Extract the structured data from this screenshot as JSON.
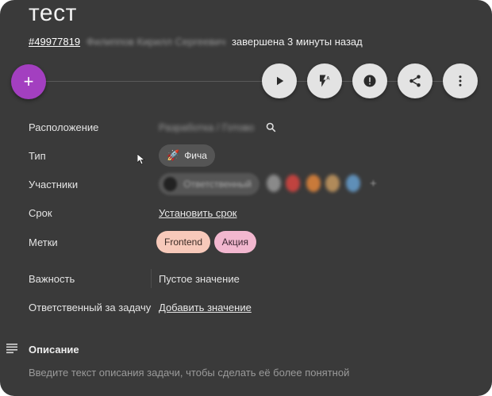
{
  "task": {
    "title": "тест",
    "id": "#49977819",
    "author": "Филиппов Кирилл Сергеевич",
    "status_text": "завершена 3 минуты назад"
  },
  "toolbar": {
    "add_label": "+",
    "buttons": [
      "play-icon",
      "flash-auto-icon",
      "priority-icon",
      "share-icon",
      "more-icon"
    ]
  },
  "fields": {
    "location": {
      "label": "Расположение",
      "value": "Разработка / Готово"
    },
    "type": {
      "label": "Тип",
      "emoji": "🚀",
      "value": "Фича"
    },
    "members": {
      "label": "Участники",
      "chip": "Ответственный",
      "more": "+"
    },
    "due": {
      "label": "Срок",
      "value": "Установить срок"
    },
    "tags": {
      "label": "Метки",
      "items": [
        "Frontend",
        "Акция"
      ]
    },
    "importance": {
      "label": "Важность",
      "value": "Пустое значение"
    },
    "assignee": {
      "label": "Ответственный за задачу",
      "value": "Добавить значение"
    }
  },
  "description": {
    "title": "Описание",
    "placeholder": "Введите текст описания задачи, чтобы сделать её более понятной"
  },
  "colors": {
    "background": "#3a3a3a",
    "fab": "#a33fc0",
    "tag_frontend": "#f7c9ba",
    "tag_promo": "#f2b7cf"
  }
}
